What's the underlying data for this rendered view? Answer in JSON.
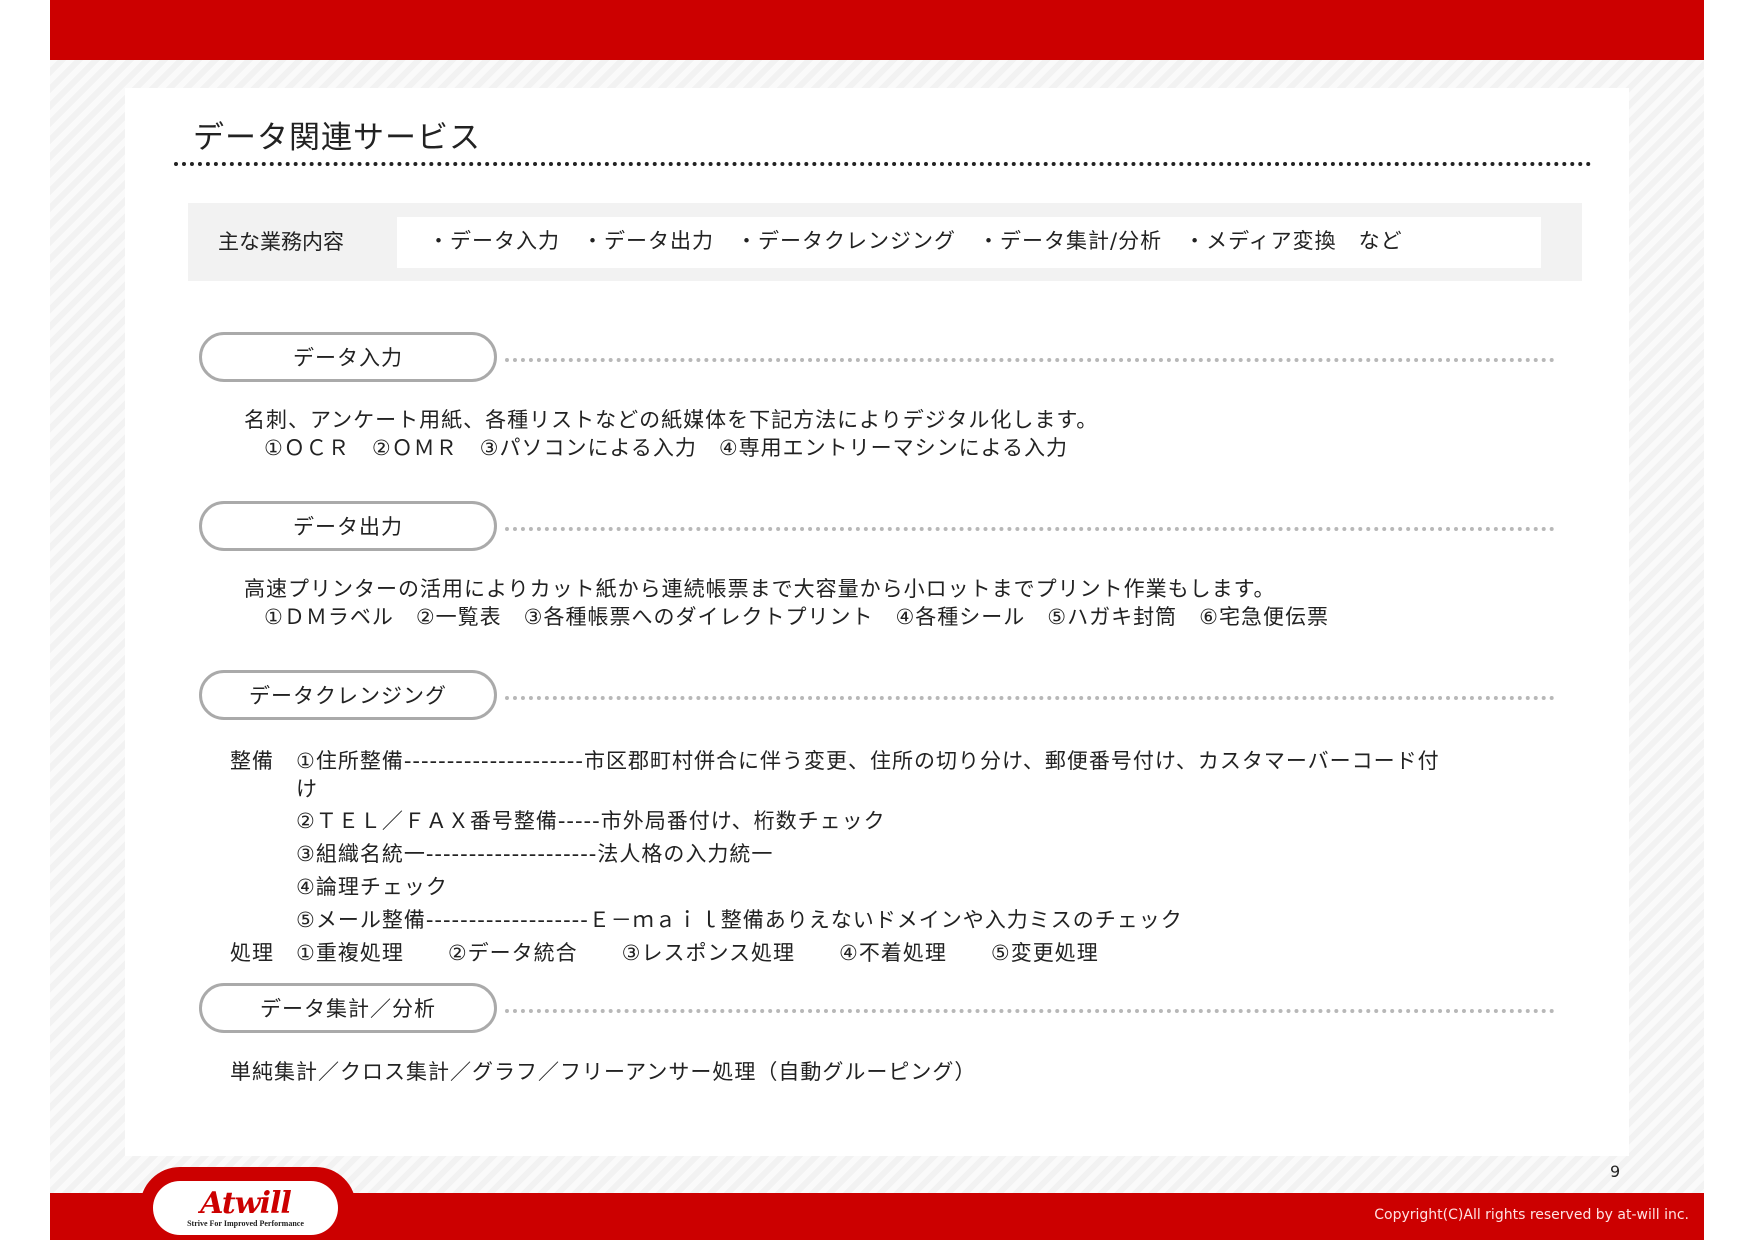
{
  "title": "データ関連サービス",
  "summary": {
    "label": "主な業務内容",
    "items": "・データ入力　・データ出力　・データクレンジング　・データ集計/分析　・メディア変換　など"
  },
  "sections": {
    "input": {
      "heading": "データ入力",
      "line1": "名刺、アンケート用紙、各種リストなどの紙媒体を下記方法によりデジタル化します。",
      "line2": "①ＯＣＲ　②ＯＭＲ　③パソコンによる入力　④専用エントリーマシンによる入力"
    },
    "output": {
      "heading": "データ出力",
      "line1": "高速プリンターの活用によりカット紙から連続帳票まで大容量から小ロットまでプリント作業もします。",
      "line2": "①ＤＭラベル　②一覧表　③各種帳票へのダイレクトプリント　④各種シール　⑤ハガキ封筒　⑥宅急便伝票"
    },
    "cleansing": {
      "heading": "データクレンジング",
      "label_seibi": "整備",
      "item1": "①住所整備---------------------市区郡町村併合に伴う変更、住所の切り分け、郵便番号付け、カスタマーバーコード付",
      "item1_wrap": "け",
      "item2": "②ＴＥＬ／ＦＡＸ番号整備-----市外局番付け、桁数チェック",
      "item3": "③組織名統一--------------------法人格の入力統一",
      "item4": "④論理チェック",
      "item5": "⑤メール整備-------------------Ｅ－ｍａｉｌ整備ありえないドメインや入力ミスのチェック",
      "label_shori": "処理",
      "process": "①重複処理　　②データ統合　　③レスポンス処理　　④不着処理　　⑤変更処理"
    },
    "analysis": {
      "heading": "データ集計／分析",
      "line1": "単純集計／クロス集計／グラフ／フリーアンサー処理（自動グルーピング）"
    }
  },
  "footer": {
    "page_number": "9",
    "copyright": "Copyright(C)All rights reserved by at-will inc.",
    "logo_text": "Atwill",
    "logo_tagline": "Strive For Improved Performance"
  },
  "colors": {
    "brand_red": "#cc0000",
    "pill_border": "#aaaaaa"
  }
}
